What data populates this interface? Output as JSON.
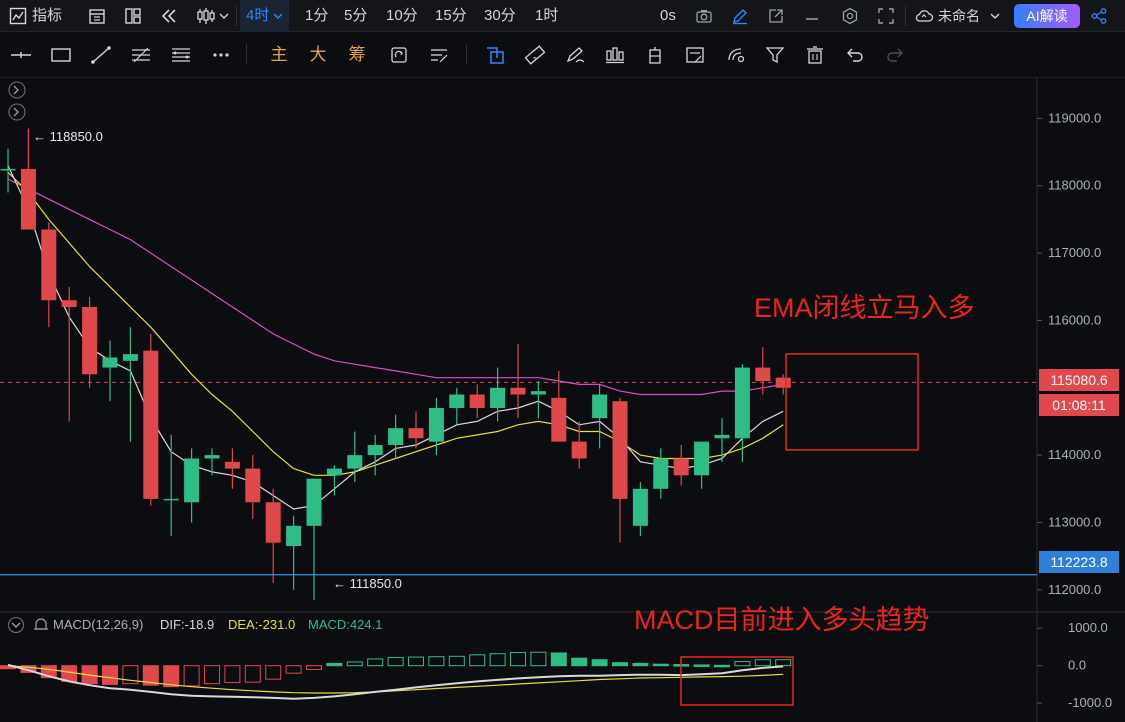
{
  "topbar": {
    "indicators_label": "指标",
    "timeframes": [
      "4时",
      "1分",
      "5分",
      "10分",
      "15分",
      "30分",
      "1时"
    ],
    "active_timeframe": "4时",
    "countdown": "0s",
    "layout_name": "未命名",
    "ai_button": "AI解读"
  },
  "drawing_toolbar": {
    "text_tools": [
      "主",
      "大",
      "筹"
    ]
  },
  "price_axis": {
    "ticks": [
      "119000.0",
      "118000.0",
      "117000.0",
      "116000.0",
      "114000.0",
      "113000.0",
      "112000.0"
    ],
    "current_price": "115080.6",
    "current_countdown": "01:08:11",
    "level_price": "112223.8",
    "high_marker": "118850.0",
    "low_marker": "111850.0"
  },
  "macd": {
    "name": "MACD(12,26,9)",
    "dif": "DIF:-18.9",
    "dea": "DEA:-231.0",
    "macd": "MACD:424.1",
    "axis_ticks": [
      "1000.0",
      "0.0",
      "-1000.0"
    ]
  },
  "annotations": {
    "ema_note": "EMA闭线立马入多",
    "macd_note": "MACD目前进入多头趋势"
  },
  "colors": {
    "up": "#2ebd85",
    "down": "#e0484c",
    "ema_short": "#d9d9d9",
    "ema_mid": "#e8df3a",
    "ema_long": "#d84fc6",
    "level_line": "#3a8ee6",
    "annotation": "#e8261e"
  },
  "chart_data": {
    "type": "candlestick",
    "timeframe": "4时",
    "ylim": [
      111700,
      119600
    ],
    "ohlc": [
      [
        118250,
        118550,
        117900,
        118250
      ],
      [
        118250,
        118850,
        117800,
        117350
      ],
      [
        117350,
        117450,
        115900,
        116300
      ],
      [
        116300,
        116500,
        114500,
        116200
      ],
      [
        116200,
        116350,
        115000,
        115200
      ],
      [
        115300,
        115700,
        114800,
        115450
      ],
      [
        115400,
        115900,
        114200,
        115500
      ],
      [
        115550,
        115800,
        113250,
        113350
      ],
      [
        113350,
        114300,
        112800,
        113350
      ],
      [
        113300,
        114100,
        113000,
        113950
      ],
      [
        113950,
        114100,
        113700,
        114000
      ],
      [
        113900,
        114100,
        113500,
        113800
      ],
      [
        113800,
        114000,
        113050,
        113300
      ],
      [
        113300,
        113500,
        112100,
        112700
      ],
      [
        112650,
        113100,
        112000,
        112950
      ],
      [
        112950,
        113650,
        111850,
        113650
      ],
      [
        113700,
        113850,
        113400,
        113800
      ],
      [
        113800,
        114350,
        113600,
        114000
      ],
      [
        114000,
        114300,
        113700,
        114150
      ],
      [
        114150,
        114600,
        113950,
        114400
      ],
      [
        114400,
        114650,
        114100,
        114250
      ],
      [
        114200,
        114850,
        114000,
        114700
      ],
      [
        114700,
        115000,
        114450,
        114900
      ],
      [
        114900,
        115050,
        114550,
        114700
      ],
      [
        114700,
        115300,
        114500,
        115000
      ],
      [
        115000,
        115650,
        114550,
        114900
      ],
      [
        114900,
        115100,
        114550,
        114950
      ],
      [
        114850,
        115250,
        114300,
        114200
      ],
      [
        114200,
        114500,
        113800,
        113950
      ],
      [
        114550,
        115050,
        114100,
        114900
      ],
      [
        114800,
        114850,
        112700,
        113350
      ],
      [
        112950,
        113600,
        112800,
        113500
      ],
      [
        113500,
        114100,
        113350,
        113950
      ],
      [
        113950,
        114150,
        113550,
        113700
      ],
      [
        113700,
        114200,
        113500,
        114200
      ],
      [
        114250,
        114550,
        113900,
        114300
      ],
      [
        114250,
        115350,
        113900,
        115300
      ],
      [
        115300,
        115600,
        114900,
        115100
      ],
      [
        115150,
        115200,
        114900,
        115000
      ]
    ],
    "ema_short": [
      118300,
      117650,
      116700,
      116050,
      115600,
      115400,
      115250,
      114550,
      114050,
      113850,
      113750,
      113700,
      113600,
      113400,
      113200,
      113250,
      113500,
      113750,
      113900,
      114100,
      114150,
      114300,
      114450,
      114500,
      114650,
      114700,
      114800,
      114650,
      114450,
      114500,
      114250,
      113900,
      113850,
      113800,
      113850,
      113950,
      114250,
      114500,
      114650
    ],
    "ema_mid": [
      118200,
      117900,
      117500,
      117150,
      116800,
      116500,
      116200,
      115900,
      115550,
      115200,
      114900,
      114650,
      114350,
      114050,
      113800,
      113700,
      113700,
      113750,
      113850,
      113950,
      114050,
      114150,
      114250,
      114300,
      114350,
      114450,
      114500,
      114450,
      114350,
      114350,
      114200,
      114000,
      113950,
      113950,
      113950,
      114000,
      114100,
      114250,
      114450
    ],
    "ema_long": [
      118100,
      117950,
      117800,
      117650,
      117500,
      117350,
      117200,
      117000,
      116800,
      116600,
      116400,
      116200,
      116000,
      115800,
      115650,
      115500,
      115400,
      115350,
      115300,
      115250,
      115200,
      115150,
      115150,
      115150,
      115150,
      115150,
      115150,
      115100,
      115050,
      115050,
      114950,
      114900,
      114900,
      114900,
      114900,
      114950,
      114950,
      115000,
      115050
    ],
    "macd_hist": [
      -80,
      -180,
      -320,
      -420,
      -480,
      -500,
      -480,
      -520,
      -560,
      -540,
      -480,
      -450,
      -440,
      -360,
      -200,
      -100,
      60,
      100,
      180,
      220,
      230,
      240,
      250,
      290,
      320,
      350,
      360,
      340,
      200,
      160,
      80,
      60,
      40,
      30,
      20,
      10,
      110,
      160,
      160
    ],
    "macd_dif": [
      20,
      -120,
      -280,
      -420,
      -520,
      -600,
      -640,
      -700,
      -760,
      -800,
      -820,
      -830,
      -840,
      -860,
      -880,
      -860,
      -820,
      -760,
      -700,
      -640,
      -580,
      -520,
      -470,
      -420,
      -380,
      -340,
      -310,
      -280,
      -270,
      -270,
      -250,
      -240,
      -240,
      -250,
      -230,
      -200,
      -120,
      -60,
      -20
    ],
    "macd_dea": [
      0,
      -40,
      -100,
      -170,
      -250,
      -320,
      -390,
      -450,
      -510,
      -560,
      -600,
      -640,
      -670,
      -700,
      -720,
      -730,
      -730,
      -720,
      -700,
      -670,
      -640,
      -610,
      -580,
      -550,
      -520,
      -490,
      -460,
      -430,
      -400,
      -370,
      -350,
      -330,
      -320,
      -310,
      -300,
      -290,
      -280,
      -260,
      -231
    ],
    "macd_ylim": [
      -1450,
      1380
    ]
  }
}
